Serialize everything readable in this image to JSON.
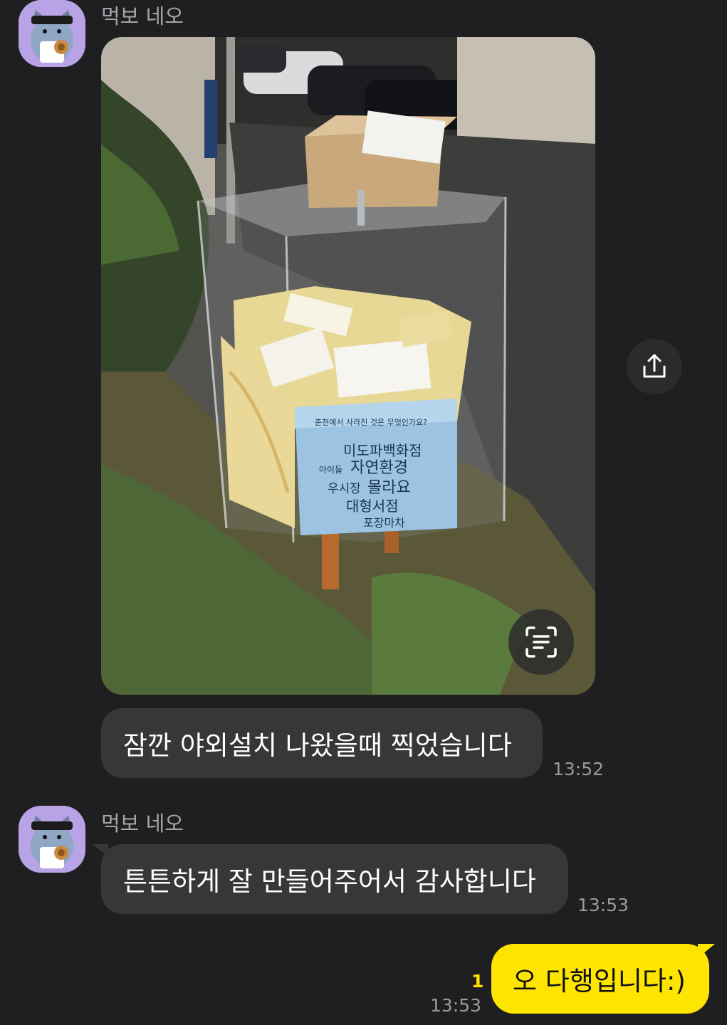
{
  "messages": [
    {
      "sender": "먹보 네오",
      "type": "photo",
      "photo_sign": {
        "question": "춘천에서 사라진 것은 무엇인가요?",
        "words": [
          "미도파백화점",
          "아이들",
          "자연환경",
          "우시장",
          "몰라요",
          "대형서점",
          "포장마차"
        ]
      }
    },
    {
      "type": "text",
      "text": "잠깐 야외설치 나왔을때 찍었습니다",
      "time": "13:52"
    },
    {
      "sender": "먹보 네오",
      "type": "text",
      "text": "튼튼하게 잘 만들어주어서 감사합니다",
      "time": "13:53"
    },
    {
      "type": "mine",
      "text": "오 다행입니다:)",
      "time": "13:53",
      "unread": "1"
    }
  ],
  "colors": {
    "background": "#1f1f21",
    "bubble_other": "#373739",
    "bubble_mine": "#fee500",
    "avatar_bg": "#b7a3e6"
  },
  "icons": {
    "share": "share-icon",
    "text_scan": "text-scan-icon"
  }
}
